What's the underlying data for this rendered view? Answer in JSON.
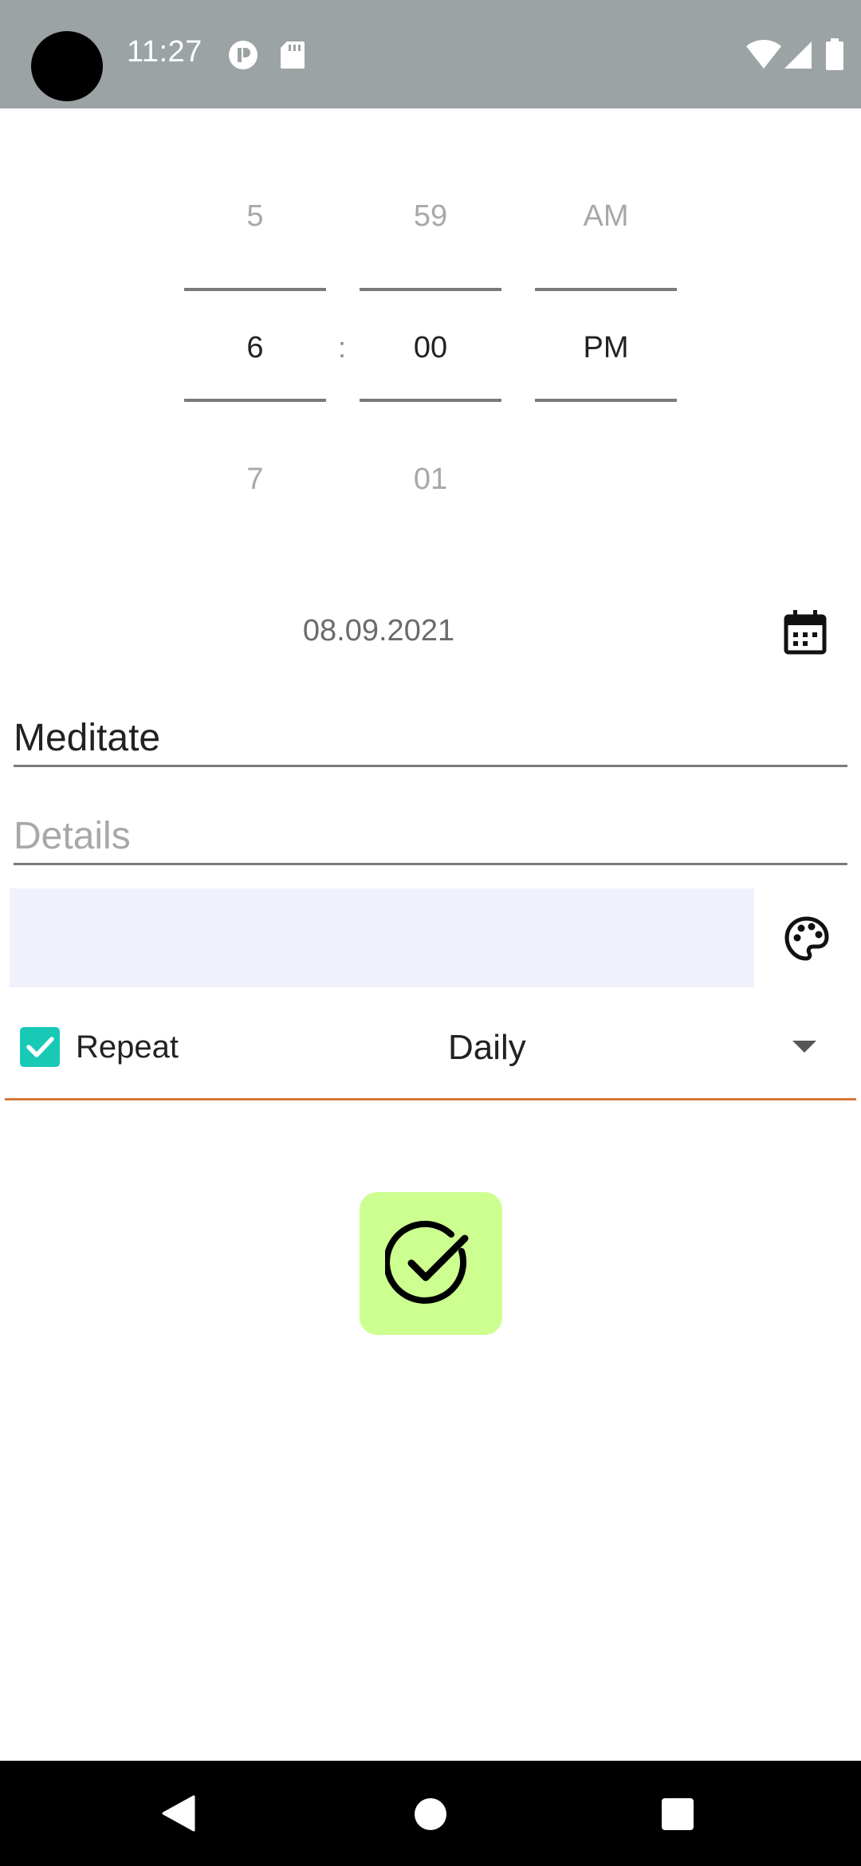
{
  "status_bar": {
    "time": "11:27",
    "icons": [
      "camera-cutout",
      "app-notification-icon",
      "sd-card-icon",
      "wifi-icon",
      "signal-icon",
      "battery-icon"
    ]
  },
  "time_picker": {
    "hour": {
      "prev": "5",
      "selected": "6",
      "next": "7"
    },
    "separator": ":",
    "minute": {
      "prev": "59",
      "selected": "00",
      "next": "01"
    },
    "period": {
      "prev": "AM",
      "selected": "PM"
    }
  },
  "date": {
    "value": "08.09.2021",
    "icon": "calendar-icon"
  },
  "form": {
    "title_value": "Meditate",
    "details_placeholder": "Details",
    "swatch_color": "#f1f1fd",
    "palette_icon": "palette-icon"
  },
  "repeat": {
    "checked": true,
    "label": "Repeat",
    "selected_option": "Daily",
    "accent_color": "#d9773a",
    "checkbox_color": "#18c9b6"
  },
  "save_button": {
    "icon": "check-circle-icon",
    "color": "#ccff8f"
  },
  "nav_bar": {
    "buttons": [
      "back-icon",
      "home-icon",
      "recents-icon"
    ]
  }
}
